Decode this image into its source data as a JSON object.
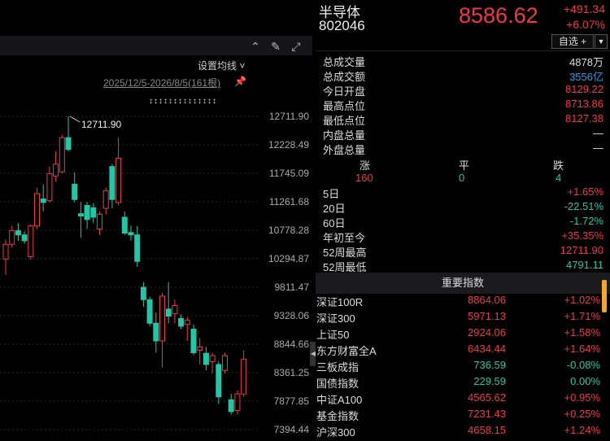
{
  "header": {
    "name": "半导体",
    "code": "802046",
    "price": "8586.62",
    "change": "+491.34",
    "change_pct": "+6.07%",
    "watch_label": "自选 +",
    "watch_more": "▼"
  },
  "chart_toolbar": {
    "ma_setting": "设置均线 ˅",
    "range_label": "2025/12/5-2026/8/5(161根)",
    "arrow_row": "↕↕↕↕↕↕↕↕↕↕↕↕↕↕",
    "icons": [
      "chevron-up-circle-icon",
      "pen-icon",
      "expand-icon"
    ]
  },
  "chart_data": {
    "type": "candlestick",
    "y_ticks": [
      "12711.90",
      "12228.49",
      "11745.09",
      "11261.68",
      "10778.28",
      "10294.87",
      "9811.47",
      "9328.06",
      "8844.66",
      "8361.25",
      "7877.85",
      "7394.44"
    ],
    "ylim": [
      7394.44,
      12711.9
    ],
    "high_label": "12711.90",
    "up_color": "#f23645",
    "down_color": "#1fc7a6",
    "candles": [
      {
        "o": 10290,
        "h": 10620,
        "l": 10020,
        "c": 10540
      },
      {
        "o": 10540,
        "h": 10850,
        "l": 10480,
        "c": 10770
      },
      {
        "o": 10770,
        "h": 10900,
        "l": 10600,
        "c": 10700
      },
      {
        "o": 10700,
        "h": 10760,
        "l": 10550,
        "c": 10600
      },
      {
        "o": 10330,
        "h": 10880,
        "l": 10280,
        "c": 10850
      },
      {
        "o": 10850,
        "h": 11500,
        "l": 10800,
        "c": 11400
      },
      {
        "o": 11310,
        "h": 11560,
        "l": 11100,
        "c": 11250
      },
      {
        "o": 11280,
        "h": 11860,
        "l": 11250,
        "c": 11740
      },
      {
        "o": 11700,
        "h": 12120,
        "l": 11600,
        "c": 11900
      },
      {
        "o": 11770,
        "h": 12400,
        "l": 11750,
        "c": 12350
      },
      {
        "o": 12350,
        "h": 12711.9,
        "l": 12120,
        "c": 12150
      },
      {
        "o": 11560,
        "h": 11760,
        "l": 11250,
        "c": 11300
      },
      {
        "o": 11060,
        "h": 11260,
        "l": 10650,
        "c": 11020
      },
      {
        "o": 11200,
        "h": 11260,
        "l": 10800,
        "c": 10960
      },
      {
        "o": 11160,
        "h": 11240,
        "l": 10900,
        "c": 11000
      },
      {
        "o": 10800,
        "h": 11100,
        "l": 10700,
        "c": 11050
      },
      {
        "o": 11150,
        "h": 11500,
        "l": 11050,
        "c": 11450
      },
      {
        "o": 11860,
        "h": 11900,
        "l": 11150,
        "c": 11300
      },
      {
        "o": 11250,
        "h": 12350,
        "l": 11200,
        "c": 12000
      },
      {
        "o": 11000,
        "h": 11100,
        "l": 10700,
        "c": 10730
      },
      {
        "o": 10740,
        "h": 10860,
        "l": 10600,
        "c": 10700
      },
      {
        "o": 10700,
        "h": 10850,
        "l": 10160,
        "c": 10250
      },
      {
        "o": 9810,
        "h": 9900,
        "l": 9480,
        "c": 9600
      },
      {
        "o": 9600,
        "h": 9650,
        "l": 9150,
        "c": 9200
      },
      {
        "o": 9200,
        "h": 9380,
        "l": 8700,
        "c": 8900
      },
      {
        "o": 8900,
        "h": 9720,
        "l": 8450,
        "c": 9660
      },
      {
        "o": 9440,
        "h": 9900,
        "l": 9200,
        "c": 9320
      },
      {
        "o": 9360,
        "h": 9600,
        "l": 9200,
        "c": 9500
      },
      {
        "o": 9280,
        "h": 9350,
        "l": 9100,
        "c": 9150
      },
      {
        "o": 9180,
        "h": 9300,
        "l": 8900,
        "c": 9250
      },
      {
        "o": 9100,
        "h": 9180,
        "l": 8660,
        "c": 8700
      },
      {
        "o": 8740,
        "h": 8950,
        "l": 8500,
        "c": 8800
      },
      {
        "o": 8690,
        "h": 8800,
        "l": 8400,
        "c": 8500
      },
      {
        "o": 8550,
        "h": 8700,
        "l": 8350,
        "c": 8650
      },
      {
        "o": 8500,
        "h": 8550,
        "l": 7830,
        "c": 7950
      },
      {
        "o": 8400,
        "h": 8700,
        "l": 8350,
        "c": 8650
      },
      {
        "o": 7900,
        "h": 8000,
        "l": 7650,
        "c": 7700
      },
      {
        "o": 7720,
        "h": 8060,
        "l": 7650,
        "c": 8000
      },
      {
        "o": 8000,
        "h": 8740,
        "l": 7950,
        "c": 8586.62
      }
    ]
  },
  "stats": [
    {
      "label": "总成交量",
      "value": "4878万",
      "color": "white"
    },
    {
      "label": "总成交额",
      "value": "3556亿",
      "color": "blue"
    },
    {
      "label": "今日开盘",
      "value": "8129.22",
      "color": "red"
    },
    {
      "label": "最高点位",
      "value": "8713.86",
      "color": "red"
    },
    {
      "label": "最低点位",
      "value": "8127.38",
      "color": "red"
    },
    {
      "label": "内盘总量",
      "value": "—",
      "color": "white"
    },
    {
      "label": "外盘总量",
      "value": "—",
      "color": "white"
    }
  ],
  "updown": {
    "up_label": "涨",
    "flat_label": "平",
    "down_label": "跌",
    "up": "160",
    "flat": "0",
    "down": "4"
  },
  "performance": [
    {
      "label": "5日",
      "value": "+1.65%",
      "color": "red"
    },
    {
      "label": "20日",
      "value": "-22.51%",
      "color": "green"
    },
    {
      "label": "60日",
      "value": "-1.72%",
      "color": "green"
    },
    {
      "label": "年初至今",
      "value": "+35.35%",
      "color": "red"
    },
    {
      "label": "52周最高",
      "value": "12711.90",
      "color": "red"
    },
    {
      "label": "52周最低",
      "value": "4791.11",
      "color": "green"
    }
  ],
  "indices": {
    "title": "重要指数",
    "rows": [
      {
        "name": "深证100R",
        "price": "8864.06",
        "change": "+1.02%",
        "pcolor": "red",
        "ccolor": "red"
      },
      {
        "name": "深证300",
        "price": "5971.13",
        "change": "+1.71%",
        "pcolor": "red",
        "ccolor": "red"
      },
      {
        "name": "上证50",
        "price": "2924.06",
        "change": "+1.58%",
        "pcolor": "red",
        "ccolor": "red"
      },
      {
        "name": "东方财富全A",
        "price": "6434.44",
        "change": "+1.64%",
        "pcolor": "red",
        "ccolor": "red"
      },
      {
        "name": "三板成指",
        "price": "736.59",
        "change": "-0.08%",
        "pcolor": "green",
        "ccolor": "green"
      },
      {
        "name": "国债指数",
        "price": "229.59",
        "change": "0.00%",
        "pcolor": "green",
        "ccolor": "green"
      },
      {
        "name": "中证A100",
        "price": "4565.62",
        "change": "+0.95%",
        "pcolor": "red",
        "ccolor": "red"
      },
      {
        "name": "基金指数",
        "price": "7231.43",
        "change": "+0.25%",
        "pcolor": "red",
        "ccolor": "red"
      },
      {
        "name": "沪深300",
        "price": "4658.15",
        "change": "+1.24%",
        "pcolor": "red",
        "ccolor": "red"
      }
    ]
  }
}
